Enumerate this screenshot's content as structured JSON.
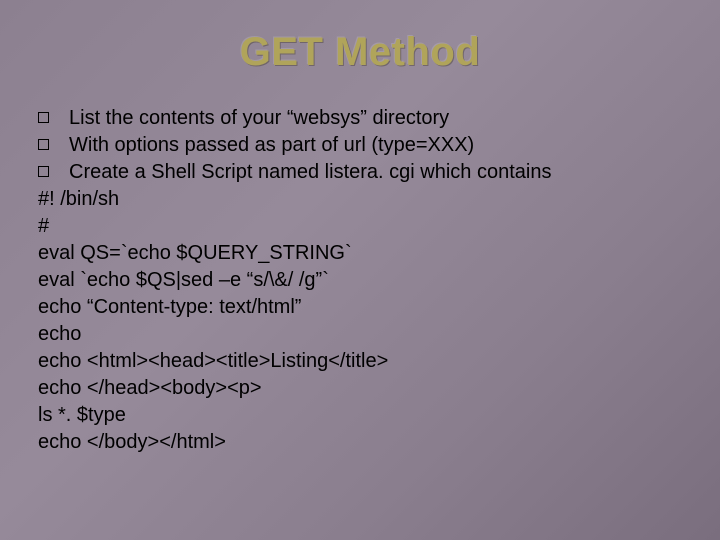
{
  "title": "GET Method",
  "bullets": [
    "List the contents of your “websys” directory",
    "With options passed as part of url (type=XXX)",
    "Create a Shell Script named listera. cgi which contains"
  ],
  "code_lines": [
    "#! /bin/sh",
    "#",
    "eval QS=`echo $QUERY_STRING`",
    "eval `echo $QS|sed –e “s/\\&/ /g”`",
    " echo “Content-type: text/html”",
    "echo",
    " echo <html><head><title>Listing</title>",
    " echo </head><body><p>",
    "ls   *. $type",
    "echo </body></html>"
  ]
}
